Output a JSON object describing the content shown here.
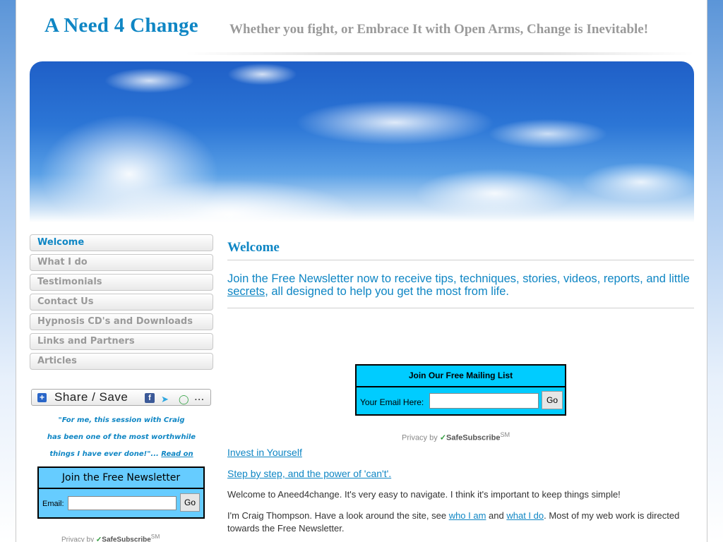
{
  "header": {
    "site_title": "A Need 4 Change",
    "tagline": "Whether you fight, or Embrace It with Open Arms, Change is Inevitable!"
  },
  "sidebar": {
    "nav": [
      {
        "label": "Welcome",
        "active": true
      },
      {
        "label": "What I do"
      },
      {
        "label": "Testimonials"
      },
      {
        "label": "Contact Us"
      },
      {
        "label": "Hypnosis CD's and Downloads"
      },
      {
        "label": "Links and Partners"
      },
      {
        "label": "Articles"
      }
    ],
    "share_label": "Share / Save",
    "share_more": "...",
    "quote_lines": [
      "\"For me, this session with Craig",
      "has been one of the most worthwhile",
      "things I have ever done!\"..."
    ],
    "quote_link": "Read on",
    "newsletter": {
      "heading": "Join the Free Newsletter",
      "email_label": "Email:",
      "button": "Go"
    },
    "privacy_prefix": "Privacy by",
    "privacy_brand": "SafeSubscribe",
    "privacy_sup": "SM"
  },
  "main": {
    "heading": "Welcome",
    "lead_before": "Join the Free Newsletter now to receive tips, techniques, stories, videos, reports, and little ",
    "lead_link": "secrets",
    "lead_after": ", all designed to help you get the most from life.",
    "mailing": {
      "heading": "Join Our Free Mailing List",
      "email_label": "Your Email Here:",
      "button": "Go"
    },
    "privacy_prefix": "Privacy by",
    "privacy_brand": "SafeSubscribe",
    "privacy_sup": "SM",
    "links": [
      "Invest in Yourself",
      "Step by step, and the power of 'can't'."
    ],
    "para1": "Welcome to Aneed4change. It's very easy to navigate. I think it's important to keep things simple!",
    "para2_a": "I'm Craig Thompson. Have a look around the site, see ",
    "para2_link1": "who I am",
    "para2_b": " and ",
    "para2_link2": "what I do",
    "para2_c": ". Most of my web work is directed towards the Free Newsletter."
  },
  "colors": {
    "accent": "#0f86c4",
    "newsletter_bg": "#66ccff",
    "mailing_bg": "#00ccff"
  }
}
